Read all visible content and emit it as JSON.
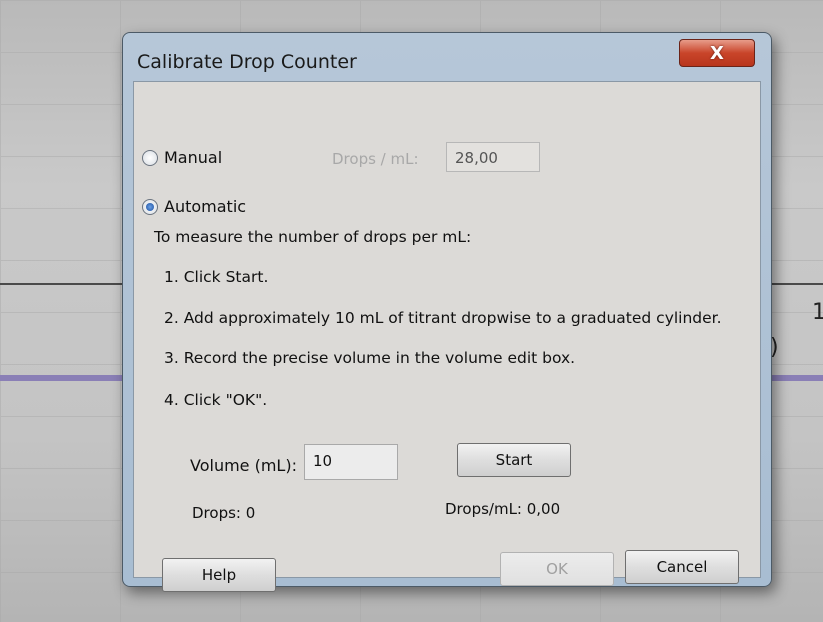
{
  "background": {
    "right_glyph": "1",
    "right_paren": ")"
  },
  "dialog": {
    "title": "Calibrate Drop Counter",
    "close_symbol": "X",
    "manual": {
      "label": "Manual",
      "checked": false,
      "drops_per_ml_label": "Drops / mL:",
      "drops_per_ml_value": "28,00"
    },
    "automatic": {
      "label": "Automatic",
      "checked": true
    },
    "instructions": {
      "heading": "To measure the number of drops per mL:",
      "steps": [
        "1. Click Start.",
        "2. Add approximately 10 mL of titrant dropwise to a graduated cylinder.",
        "3. Record the precise volume in the volume edit box.",
        "4. Click \"OK\"."
      ]
    },
    "volume": {
      "label": "Volume (mL):",
      "value": "10"
    },
    "start_label": "Start",
    "drops_text": "Drops: 0",
    "drops_per_ml_text": "Drops/mL: 0,00",
    "buttons": {
      "help": "Help",
      "ok": "OK",
      "cancel": "Cancel"
    }
  }
}
